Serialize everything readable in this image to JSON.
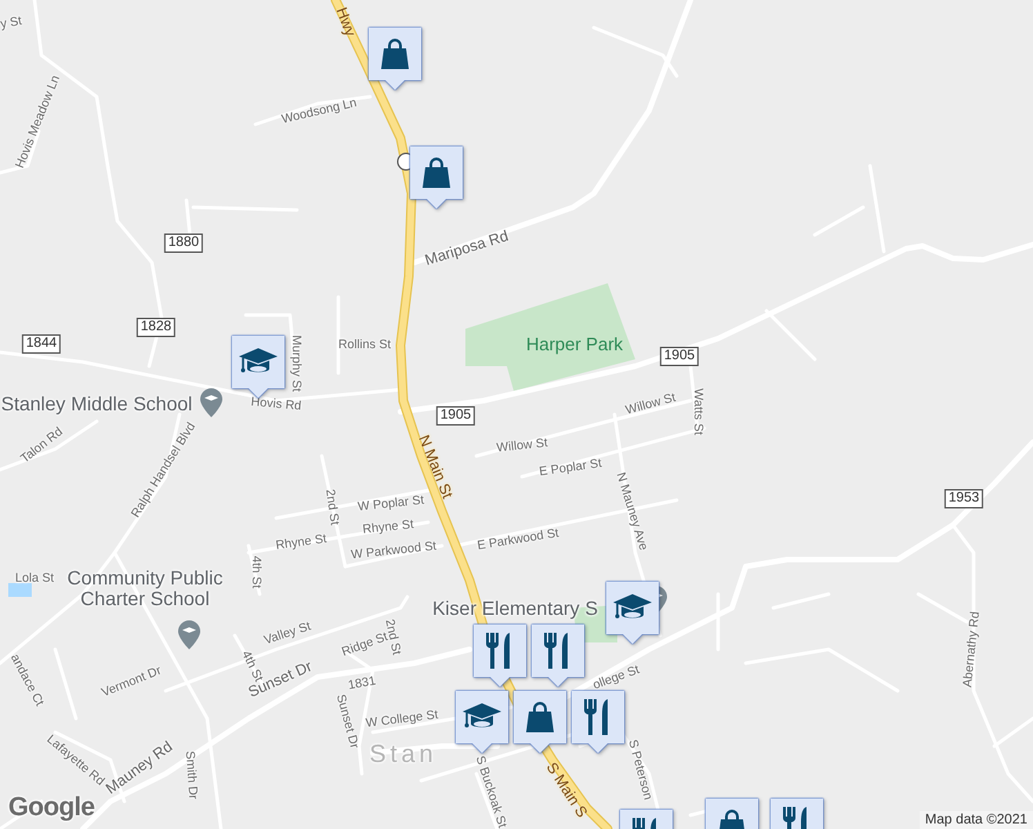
{
  "map": {
    "labels": [
      {
        "kind": "highway",
        "text": "Hwy"
      },
      {
        "kind": "street",
        "text": "Woodsong Ln"
      },
      {
        "kind": "street",
        "text": "Hovis Meadow Ln"
      },
      {
        "kind": "street",
        "text": "y St"
      },
      {
        "kind": "street-major",
        "text": "Mariposa Rd"
      },
      {
        "kind": "shield",
        "text": "1880"
      },
      {
        "kind": "shield",
        "text": "1828"
      },
      {
        "kind": "shield",
        "text": "1844"
      },
      {
        "kind": "street",
        "text": "Rollins St"
      },
      {
        "kind": "street",
        "text": "Murphy St"
      },
      {
        "kind": "street",
        "text": "Hovis Rd"
      },
      {
        "kind": "poi",
        "text": "Stanley Middle School"
      },
      {
        "kind": "park",
        "text": "Harper Park"
      },
      {
        "kind": "shield",
        "text": "1905"
      },
      {
        "kind": "shield",
        "text": "1905"
      },
      {
        "kind": "street",
        "text": "Willow St"
      },
      {
        "kind": "street",
        "text": "Watts St"
      },
      {
        "kind": "street",
        "text": "Willow St"
      },
      {
        "kind": "street",
        "text": "E Poplar St"
      },
      {
        "kind": "highway",
        "text": "N Main St"
      },
      {
        "kind": "street",
        "text": "N Mauney Ave"
      },
      {
        "kind": "shield",
        "text": "1953"
      },
      {
        "kind": "street",
        "text": "Abernathy Rd"
      },
      {
        "kind": "street",
        "text": "Talon Rd"
      },
      {
        "kind": "street",
        "text": "Ralph Handsel Blvd"
      },
      {
        "kind": "street",
        "text": "W Poplar St"
      },
      {
        "kind": "street",
        "text": "2nd St"
      },
      {
        "kind": "street",
        "text": "Rhyne St"
      },
      {
        "kind": "street",
        "text": "Rhyne St"
      },
      {
        "kind": "street",
        "text": "W Parkwood St"
      },
      {
        "kind": "street",
        "text": "E Parkwood St"
      },
      {
        "kind": "street",
        "text": "4th St"
      },
      {
        "kind": "street",
        "text": "Lola St"
      },
      {
        "kind": "poi",
        "text": "Community Public Charter School"
      },
      {
        "kind": "poi",
        "text": "Kiser Elementary S"
      },
      {
        "kind": "street",
        "text": "andace Ct"
      },
      {
        "kind": "street",
        "text": "Vermont Dr"
      },
      {
        "kind": "street",
        "text": "Valley St"
      },
      {
        "kind": "street",
        "text": "Ridge St"
      },
      {
        "kind": "street",
        "text": "2nd St"
      },
      {
        "kind": "street",
        "text": "4th St"
      },
      {
        "kind": "street",
        "text": "1831"
      },
      {
        "kind": "street-major",
        "text": "Sunset Dr"
      },
      {
        "kind": "street",
        "text": "Sunset Dr"
      },
      {
        "kind": "street",
        "text": "W College St"
      },
      {
        "kind": "town",
        "text": "Stan"
      },
      {
        "kind": "street-major",
        "text": "Mauney Rd"
      },
      {
        "kind": "street",
        "text": "Smith Dr"
      },
      {
        "kind": "street",
        "text": "Lafayette Rd"
      },
      {
        "kind": "street",
        "text": "S Buckoak St"
      },
      {
        "kind": "highway",
        "text": "S Main S"
      },
      {
        "kind": "street",
        "text": "S Peterson"
      },
      {
        "kind": "street",
        "text": "ollege St"
      }
    ],
    "markers": [
      {
        "kind": "shopping"
      },
      {
        "kind": "shopping"
      },
      {
        "kind": "school"
      },
      {
        "kind": "school"
      },
      {
        "kind": "restaurant"
      },
      {
        "kind": "restaurant"
      },
      {
        "kind": "school"
      },
      {
        "kind": "shopping"
      },
      {
        "kind": "restaurant"
      },
      {
        "kind": "restaurant"
      },
      {
        "kind": "shopping"
      },
      {
        "kind": "restaurant"
      }
    ],
    "logo": "Google",
    "attribution": "Map data ©2021"
  }
}
